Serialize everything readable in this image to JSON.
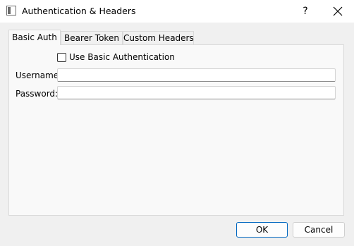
{
  "window": {
    "title": "Authentication & Headers",
    "help_label": "?"
  },
  "tabs": [
    {
      "label": "Basic Auth",
      "active": true
    },
    {
      "label": "Bearer Token",
      "active": false
    },
    {
      "label": "Custom Headers",
      "active": false
    }
  ],
  "basic_auth": {
    "use_basic_label": "Use Basic Authentication",
    "use_basic_checked": false,
    "username_label": "Username:",
    "username_value": "",
    "password_label": "Password:",
    "password_value": ""
  },
  "buttons": {
    "ok_label": "OK",
    "cancel_label": "Cancel"
  },
  "colors": {
    "accent": "#0067c0",
    "background": "#f0f0f0",
    "panel": "#f9f9f9"
  }
}
